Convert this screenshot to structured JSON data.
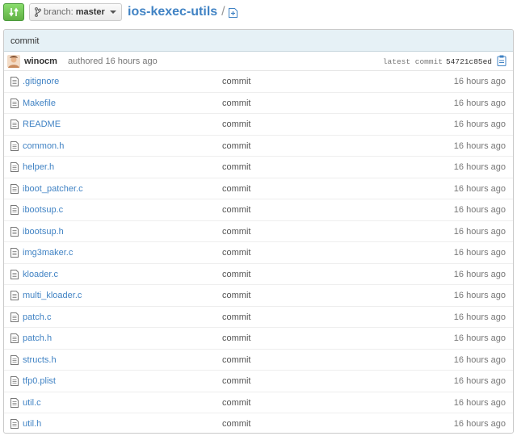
{
  "header": {
    "branch_label": "branch:",
    "branch_name": "master",
    "repo_name": "ios-kexec-utils",
    "path_separator": "/"
  },
  "commit": {
    "title": "commit",
    "author": "winocm",
    "authored_text": "authored 16 hours ago",
    "latest_label": "latest commit",
    "sha": "54721c85ed"
  },
  "files": [
    {
      "name": ".gitignore",
      "message": "commit",
      "age": "16 hours ago"
    },
    {
      "name": "Makefile",
      "message": "commit",
      "age": "16 hours ago"
    },
    {
      "name": "README",
      "message": "commit",
      "age": "16 hours ago"
    },
    {
      "name": "common.h",
      "message": "commit",
      "age": "16 hours ago"
    },
    {
      "name": "helper.h",
      "message": "commit",
      "age": "16 hours ago"
    },
    {
      "name": "iboot_patcher.c",
      "message": "commit",
      "age": "16 hours ago"
    },
    {
      "name": "ibootsup.c",
      "message": "commit",
      "age": "16 hours ago"
    },
    {
      "name": "ibootsup.h",
      "message": "commit",
      "age": "16 hours ago"
    },
    {
      "name": "img3maker.c",
      "message": "commit",
      "age": "16 hours ago"
    },
    {
      "name": "kloader.c",
      "message": "commit",
      "age": "16 hours ago"
    },
    {
      "name": "multi_kloader.c",
      "message": "commit",
      "age": "16 hours ago"
    },
    {
      "name": "patch.c",
      "message": "commit",
      "age": "16 hours ago"
    },
    {
      "name": "patch.h",
      "message": "commit",
      "age": "16 hours ago"
    },
    {
      "name": "structs.h",
      "message": "commit",
      "age": "16 hours ago"
    },
    {
      "name": "tfp0.plist",
      "message": "commit",
      "age": "16 hours ago"
    },
    {
      "name": "util.c",
      "message": "commit",
      "age": "16 hours ago"
    },
    {
      "name": "util.h",
      "message": "commit",
      "age": "16 hours ago"
    }
  ],
  "icons": {
    "compare": "compare-icon",
    "branch": "branch-icon",
    "add_file": "add-file-icon",
    "avatar": "avatar",
    "clipboard": "clipboard-icon",
    "file": "file-icon"
  },
  "colors": {
    "link": "#4183c4",
    "compare_button": "#60b044",
    "commit_header_bg": "#e6f1f6"
  }
}
